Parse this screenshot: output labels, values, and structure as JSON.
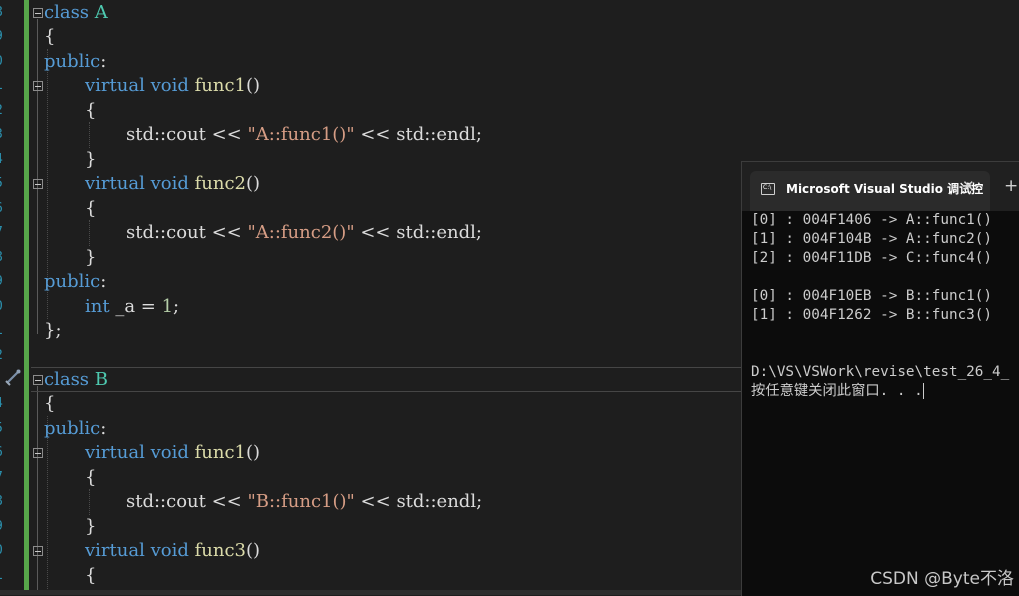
{
  "editor": {
    "line_numbers": [
      "8",
      "9",
      "0",
      "1",
      "2",
      "3",
      "4",
      "5",
      "6",
      "7",
      "8",
      "9",
      "0",
      "1",
      "2",
      "3",
      "4",
      "5",
      "6",
      "7",
      "8",
      "9",
      "0",
      "1"
    ],
    "code": {
      "class_a_decl": {
        "kw": "class",
        "name": "A"
      },
      "brace_open": "{",
      "public": "public",
      "colon": ":",
      "virtual": "virtual",
      "void": "void",
      "int": "int",
      "func1": "func1",
      "func2": "func2",
      "func3": "func3",
      "parens": "()",
      "std_cout": "std::cout",
      "shift": " << ",
      "std_endl": "std::endl",
      "semicolon": ";",
      "str_a_func1": "\"A::func1()\"",
      "str_a_func2": "\"A::func2()\"",
      "str_b_func1": "\"B::func1()\"",
      "member_a": "_a",
      "assign": " = ",
      "value_1": "1",
      "brace_close": "}",
      "class_end": "};",
      "class_b_decl": {
        "kw": "class",
        "name": "B"
      }
    }
  },
  "console": {
    "tab_title": "Microsoft Visual Studio 调试控",
    "tab_icon_text": "C:\\",
    "close_symbol": "✕",
    "new_tab_symbol": "+",
    "lines": [
      "[0] : 004F1406 -> A::func1()",
      "[1] : 004F104B -> A::func2()",
      "[2] : 004F11DB -> C::func4()",
      "",
      "[0] : 004F10EB -> B::func1()",
      "[1] : 004F1262 -> B::func3()",
      "",
      "",
      "D:\\VS\\VSWork\\revise\\test_26_4_",
      "按任意键关闭此窗口. . ."
    ]
  },
  "watermark": "CSDN @Byte不洛",
  "colors": {
    "keyword": "#569cd6",
    "class_name": "#4ec9b0",
    "function": "#dcdcaa",
    "string": "#d69d85",
    "number": "#b5cea8",
    "change_bar": "#57a64a",
    "editor_bg": "#1e1e1e",
    "console_bg": "#0c0c0c"
  }
}
